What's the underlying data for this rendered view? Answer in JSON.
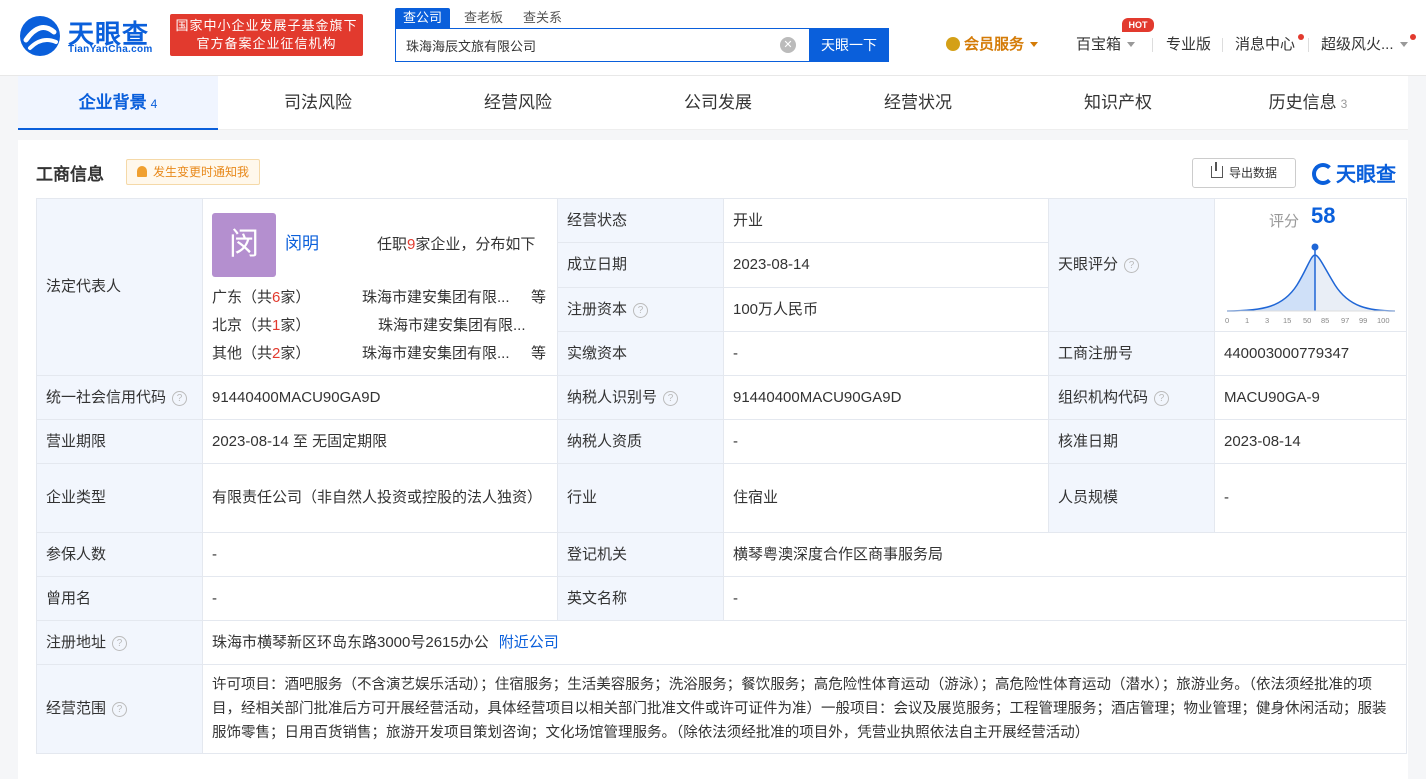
{
  "header": {
    "logo_text": "天眼查",
    "logo_sub": "TianYanCha.com",
    "banner_line1": "国家中小企业发展子基金旗下",
    "banner_line2": "官方备案企业征信机构",
    "search_tabs": [
      "查公司",
      "查老板",
      "查关系"
    ],
    "search_value": "珠海海辰文旅有限公司",
    "search_button": "天眼一下",
    "nav": {
      "vip": "会员服务",
      "treasure": "百宝箱",
      "hot": "HOT",
      "pro": "专业版",
      "messages": "消息中心",
      "user": "超级风火..."
    }
  },
  "tabs": [
    {
      "label": "企业背景",
      "count": "4"
    },
    {
      "label": "司法风险",
      "count": ""
    },
    {
      "label": "经营风险",
      "count": ""
    },
    {
      "label": "公司发展",
      "count": ""
    },
    {
      "label": "经营状况",
      "count": ""
    },
    {
      "label": "知识产权",
      "count": ""
    },
    {
      "label": "历史信息",
      "count": "3"
    }
  ],
  "section": {
    "title": "工商信息",
    "notify": "发生变更时通知我",
    "export": "导出数据",
    "brand": "天眼查"
  },
  "legal": {
    "label": "法定代表人",
    "avatar_char": "闵",
    "name": "闵明",
    "count_prefix": "任职",
    "count": "9",
    "count_suffix": "家企业，分布如下",
    "distribution": [
      {
        "region": "广东（共",
        "num": "6",
        "unit": "家）",
        "company": "珠海市建安集团有限...",
        "etc": "等"
      },
      {
        "region": "北京（共",
        "num": "1",
        "unit": "家）",
        "company": "珠海市建安集团有限...",
        "etc": ""
      },
      {
        "region": "其他（共",
        "num": "2",
        "unit": "家）",
        "company": "珠海市建安集团有限...",
        "etc": "等"
      }
    ]
  },
  "score": {
    "label": "天眼评分",
    "score_label": "评分",
    "value": 58,
    "ticks": [
      "0",
      "1",
      "3",
      "15",
      "50",
      "85",
      "97",
      "99",
      "100"
    ]
  },
  "fields": {
    "status_label": "经营状态",
    "status": "开业",
    "founded_label": "成立日期",
    "founded": "2023-08-14",
    "capital_label": "注册资本",
    "capital": "100万人民币",
    "paid_label": "实缴资本",
    "paid": "-",
    "regno_label": "工商注册号",
    "regno": "440003000779347",
    "credit_label": "统一社会信用代码",
    "credit": "91440400MACU90GA9D",
    "taxid_label": "纳税人识别号",
    "taxid": "91440400MACU90GA9D",
    "org_label": "组织机构代码",
    "org": "MACU90GA-9",
    "period_label": "营业期限",
    "period": "2023-08-14 至 无固定期限",
    "taxq_label": "纳税人资质",
    "taxq": "-",
    "approve_label": "核准日期",
    "approve": "2023-08-14",
    "type_label": "企业类型",
    "type": "有限责任公司（非自然人投资或控股的法人独资）",
    "industry_label": "行业",
    "industry": "住宿业",
    "staff_label": "人员规模",
    "staff": "-",
    "insured_label": "参保人数",
    "insured": "-",
    "authority_label": "登记机关",
    "authority": "横琴粤澳深度合作区商事服务局",
    "former_label": "曾用名",
    "former": "-",
    "english_label": "英文名称",
    "english": "-",
    "address_label": "注册地址",
    "address": "珠海市横琴新区环岛东路3000号2615办公",
    "nearby": "附近公司",
    "scope_label": "经营范围",
    "scope": "许可项目：酒吧服务（不含演艺娱乐活动）；住宿服务；生活美容服务；洗浴服务；餐饮服务；高危险性体育运动（游泳）；高危险性体育运动（潜水）；旅游业务。（依法须经批准的项目，经相关部门批准后方可开展经营活动，具体经营项目以相关部门批准文件或许可证件为准）一般项目：会议及展览服务；工程管理服务；酒店管理；物业管理；健身休闲活动；服装服饰零售；日用百货销售；旅游开发项目策划咨询；文化场馆管理服务。（除依法须经批准的项目外，凭营业执照依法自主开展经营活动）"
  }
}
